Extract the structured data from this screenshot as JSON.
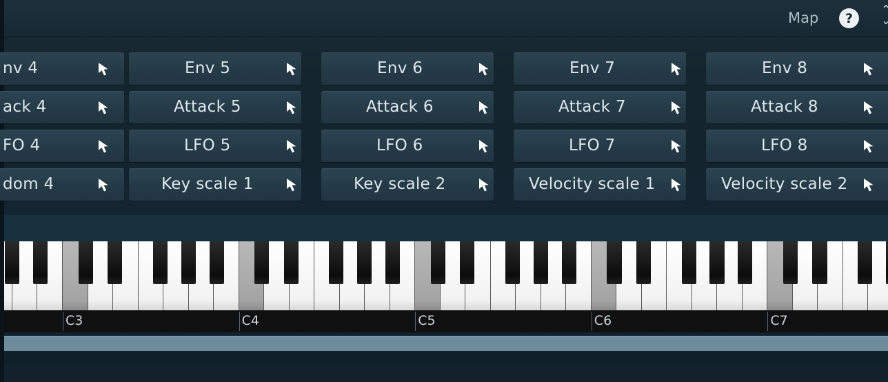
{
  "header": {
    "map_label": "Map",
    "help_label": "?",
    "updown_up": "⌃",
    "updown_down": "⌄"
  },
  "modulators": {
    "columns": [
      {
        "rows": [
          "nv 4",
          "ack 4",
          "FO 4",
          "dom 4"
        ]
      },
      {
        "rows": [
          "Env 5",
          "Attack 5",
          "LFO 5",
          "Key scale 1"
        ]
      },
      {
        "rows": [
          "Env 6",
          "Attack 6",
          "LFO 6",
          "Key scale 2"
        ]
      },
      {
        "rows": [
          "Env 7",
          "Attack 7",
          "LFO 7",
          "Velocity scale 1"
        ]
      },
      {
        "rows": [
          "Env 8",
          "Attack 8",
          "LFO 8",
          "Velocity scale 2"
        ]
      }
    ]
  },
  "keyboard": {
    "octave_labels": [
      "C3",
      "C4",
      "C5",
      "C6",
      "C7"
    ]
  },
  "colors": {
    "panel": "#1a2d38",
    "button": "#2c4452",
    "text": "#dde6eb",
    "slider": "#6e8b9c"
  },
  "icons": {
    "select": "cursor-arrow-icon",
    "help": "question-mark-icon",
    "expand": "chevron-updown-icon"
  }
}
